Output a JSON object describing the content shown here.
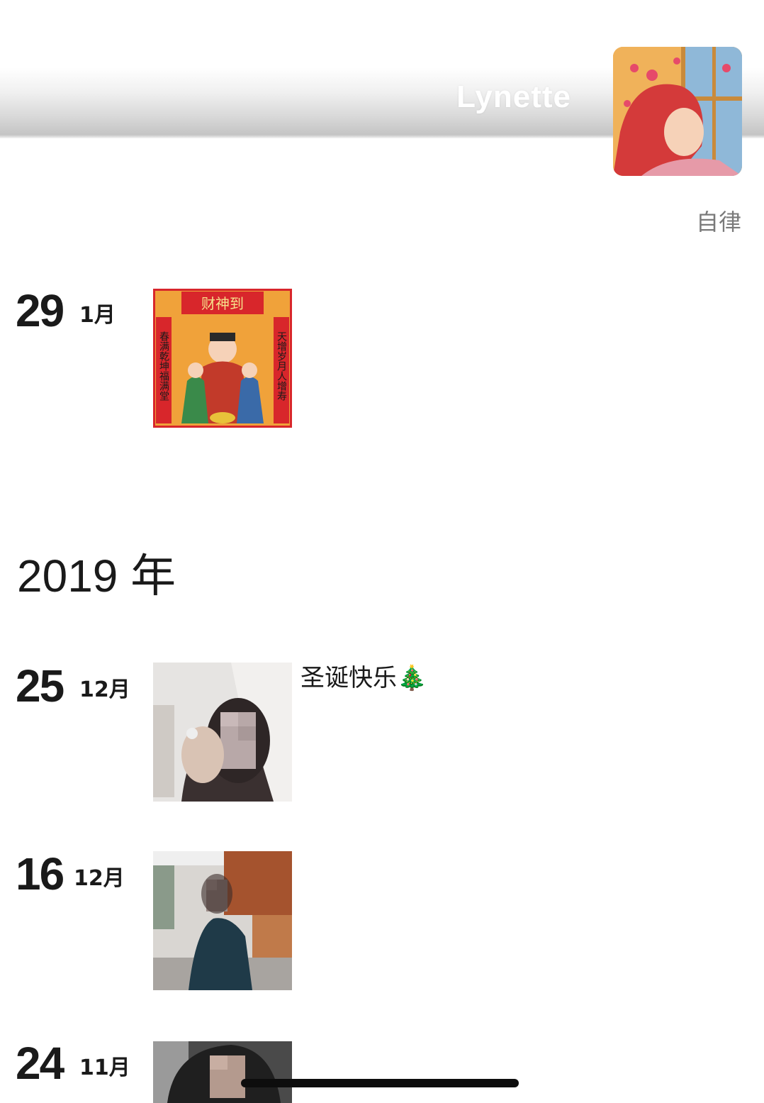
{
  "profile": {
    "username": "Lynette",
    "signature": "自律"
  },
  "timeline": {
    "year_2019_label": "2019 年",
    "posts": [
      {
        "day": "29",
        "month": "1月",
        "caption": "",
        "image": "caishen-poster"
      },
      {
        "day": "25",
        "month": "12月",
        "caption": "圣诞快乐🎄",
        "image": "selfie-photo"
      },
      {
        "day": "16",
        "month": "12月",
        "caption": "",
        "image": "cafe-photo"
      },
      {
        "day": "24",
        "month": "11月",
        "caption": "",
        "image": "portrait-photo"
      }
    ]
  },
  "poster_text": {
    "banner": "财神到",
    "left_couplet": "春满乾坤福满堂",
    "right_couplet": "天增岁月人增寿"
  },
  "colors": {
    "accent_red": "#d8262b",
    "poster_orange": "#f0a23a",
    "home_indicator": "#0d0d0d"
  }
}
